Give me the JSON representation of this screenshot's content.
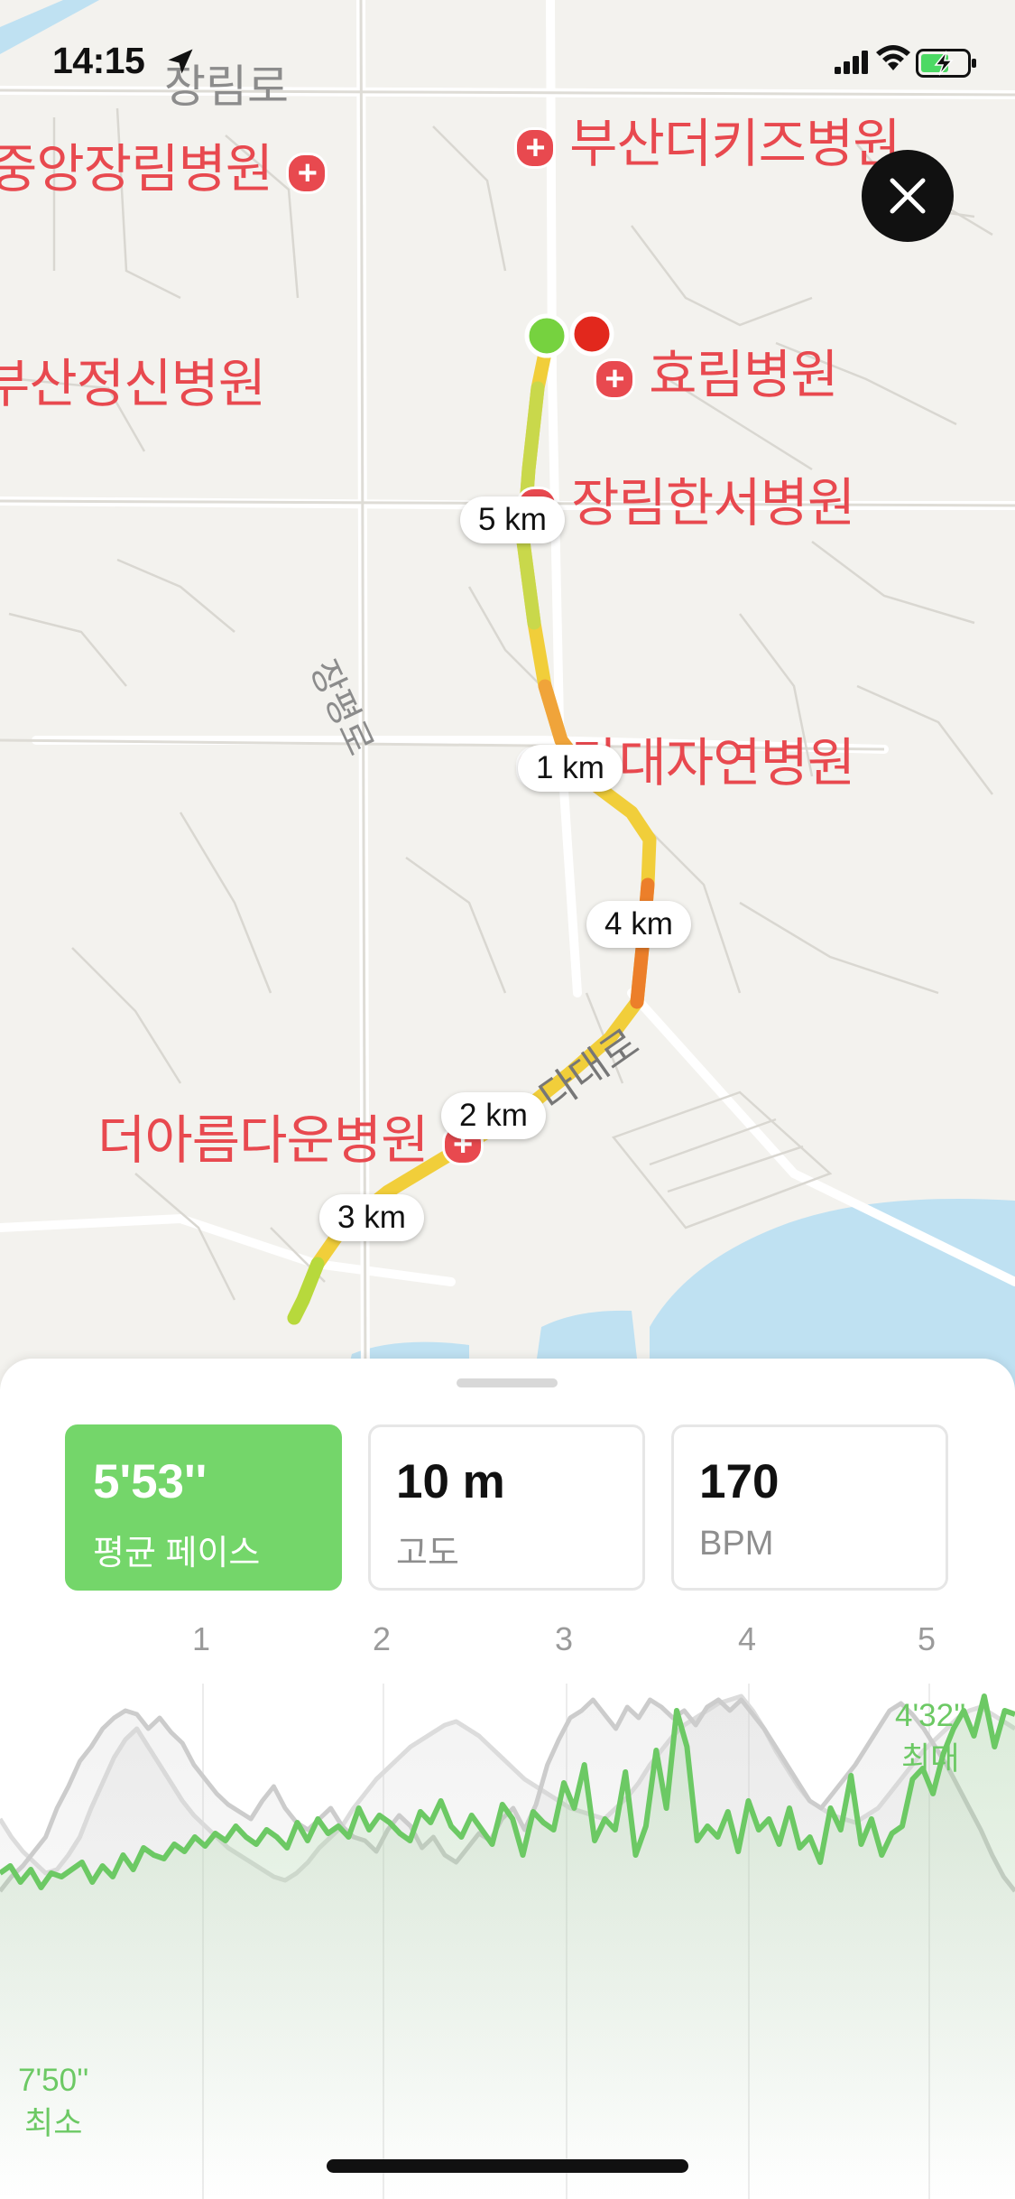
{
  "status_bar": {
    "time": "14:15"
  },
  "map": {
    "pois": [
      {
        "name": "중앙장림병원"
      },
      {
        "name": "부산더키즈병원"
      },
      {
        "name": "부산정신병원"
      },
      {
        "name": "효림병원"
      },
      {
        "name": "장림한서병원"
      },
      {
        "name": "다대자연병원"
      },
      {
        "name": "더아름다운병원"
      }
    ],
    "roads": [
      "장림로",
      "장평로",
      "다대로"
    ],
    "km_markers": [
      "5 km",
      "1 km",
      "4 km",
      "2 km",
      "3 km"
    ]
  },
  "stats": [
    {
      "value": "5'53''",
      "label": "평균 페이스",
      "active": true
    },
    {
      "value": "10 m",
      "label": "고도",
      "active": false
    },
    {
      "value": "170",
      "label": "BPM",
      "active": false
    }
  ],
  "chart_data": {
    "type": "line",
    "x_ticks": [
      "1",
      "2",
      "3",
      "4",
      "5"
    ],
    "max_label": {
      "value": "4'32''",
      "label": "최대"
    },
    "min_label": {
      "value": "7'50''",
      "label": "최소"
    },
    "series": [
      {
        "color": "#6cc964",
        "values": [
          60,
          64,
          55,
          62,
          52,
          60,
          58,
          62,
          66,
          55,
          64,
          58,
          70,
          62,
          74,
          70,
          68,
          76,
          72,
          80,
          75,
          82,
          78,
          86,
          80,
          76,
          84,
          80,
          74,
          88,
          78,
          90,
          82,
          86,
          80,
          96,
          84,
          92,
          88,
          82,
          78,
          94,
          88,
          100,
          86,
          80,
          92,
          84,
          76,
          98,
          90,
          70,
          94,
          88,
          84,
          110,
          96,
          120,
          78,
          90,
          84,
          116,
          70,
          86,
          128,
          96,
          150,
          130,
          78,
          86,
          80,
          94,
          72,
          100,
          84,
          90,
          76,
          96,
          74,
          80,
          66,
          96,
          84,
          114,
          76,
          90,
          70,
          82,
          86,
          112,
          118,
          104,
          126,
          140,
          150,
          136,
          158,
          130,
          150,
          148
        ]
      },
      {
        "color": "#cccccc",
        "values": [
          50,
          58,
          64,
          72,
          80,
          96,
          108,
          122,
          130,
          140,
          146,
          150,
          148,
          140,
          146,
          138,
          132,
          120,
          112,
          104,
          98,
          94,
          90,
          100,
          108,
          96,
          88,
          84,
          90,
          96,
          86,
          80,
          78,
          72,
          84,
          92,
          86,
          74,
          80,
          70,
          66,
          74,
          82,
          78,
          90,
          96,
          84,
          98,
          120,
          134,
          146,
          150,
          156,
          148,
          140,
          152,
          146,
          156,
          152,
          146,
          150,
          142,
          152,
          156,
          150,
          156,
          148,
          140,
          130,
          120,
          110,
          100,
          96,
          104,
          112,
          120,
          130,
          140,
          150,
          154,
          148,
          140,
          130,
          120,
          108,
          96,
          84,
          70,
          58,
          50
        ]
      },
      {
        "color": "#dcdcdc",
        "values": [
          90,
          80,
          72,
          66,
          60,
          62,
          70,
          80,
          96,
          110,
          124,
          134,
          140,
          130,
          120,
          110,
          100,
          92,
          86,
          80,
          74,
          70,
          66,
          62,
          58,
          56,
          60,
          66,
          74,
          80,
          86,
          96,
          104,
          112,
          118,
          124,
          130,
          134,
          138,
          142,
          144,
          140,
          136,
          130,
          124,
          118,
          112,
          108,
          104,
          100,
          96,
          94,
          92,
          90,
          96,
          102,
          110,
          120,
          128,
          136,
          142,
          146,
          150,
          154,
          156,
          158,
          150,
          140,
          128,
          118,
          108,
          100,
          96,
          92,
          90,
          88,
          92,
          96,
          104,
          112,
          120,
          128,
          134,
          140,
          146,
          150,
          152,
          148,
          144,
          140
        ]
      }
    ]
  }
}
